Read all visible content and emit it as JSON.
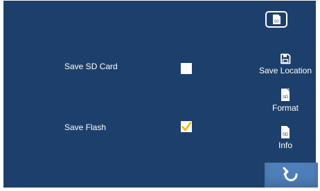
{
  "settings": {
    "save_sd_card_label": "Save SD Card",
    "save_sd_card_checked": false,
    "save_flash_label": "Save Flash",
    "save_flash_checked": true
  },
  "sidebar": {
    "sd_icon_text": "SD",
    "save_location_label": "Save Location",
    "format_label": "Format",
    "format_icon_text": "SD",
    "info_label": "Info",
    "info_icon_text": "SD"
  },
  "colors": {
    "background": "#1d3f6b",
    "checkmark": "#f5b400",
    "back_button": "#4f7fb8"
  },
  "icons": [
    "sd-card-icon",
    "floppy-disk-icon",
    "sd-format-icon",
    "sd-info-icon",
    "back-arrow-icon"
  ]
}
